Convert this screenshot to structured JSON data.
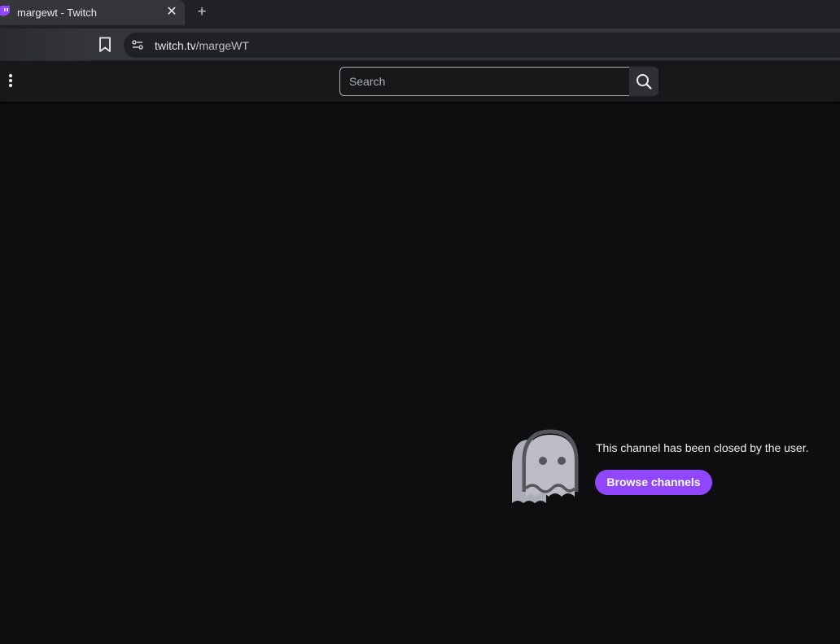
{
  "browser": {
    "tab": {
      "title": "margewt - Twitch",
      "favicon": "twitch-logo-icon",
      "close_symbol": "✕"
    },
    "new_tab_symbol": "+",
    "address": {
      "host": "twitch.tv",
      "path": "/margeWT"
    }
  },
  "nav": {
    "more_icon": "vertical-dots-icon",
    "search_placeholder": "Search",
    "search_icon": "search-icon"
  },
  "main": {
    "icon": "ghost-icon",
    "message": "This channel has been closed by the user.",
    "browse_label": "Browse channels"
  },
  "colors": {
    "accent": "#9147ff",
    "background": "#0e0e10",
    "nav_bg": "#18181b"
  }
}
